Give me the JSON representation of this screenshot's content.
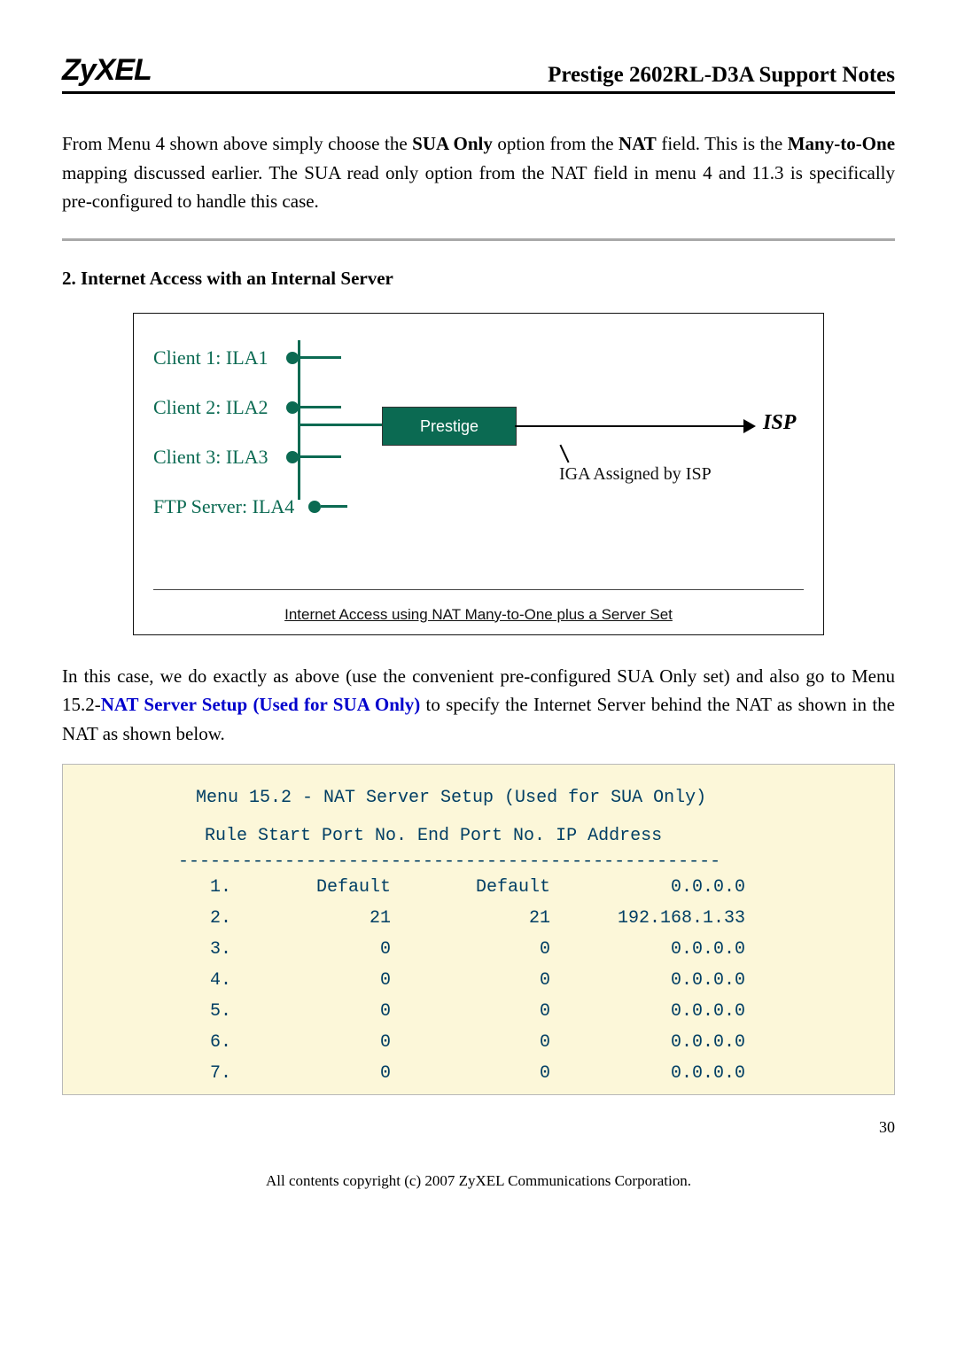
{
  "header": {
    "logo": "ZyXEL",
    "title": "Prestige 2602RL-D3A Support Notes"
  },
  "para1_pre": "From Menu 4 shown above simply choose the ",
  "para1_b1": "SUA Only",
  "para1_mid1": " option from the ",
  "para1_b2": "NAT",
  "para1_mid2": " field. This is the ",
  "para1_b3": "Many-to-One",
  "para1_post": " mapping discussed earlier. The SUA read only option from the NAT field in menu 4 and 11.3 is specifically pre-configured to handle this case.",
  "subhead": "2. Internet Access with an Internal Server",
  "diagram": {
    "c1": "Client 1: ILA1",
    "c2": "Client 2: ILA2",
    "c3": "Client 3: ILA3",
    "c4": "FTP Server: ILA4",
    "box": "Prestige",
    "isp": "ISP",
    "assigned": "IGA Assigned by ISP",
    "caption": "Internet Access using NAT Many-to-One plus a Server Set"
  },
  "para2_pre": "In this case, we do exactly as above (use the convenient pre-configured SUA Only set) and also go to Menu 15.2-",
  "para2_link": "NAT Server Setup (Used for SUA Only)",
  "para2_post": " to specify the Internet Server behind the NAT as shown in the NAT as shown below.",
  "code": {
    "title": "Menu 15.2 - NAT Server Setup (Used for SUA Only)",
    "sub": "Rule Start Port No. End Port No. IP Address",
    "dashes": "---------------------------------------------------"
  },
  "chart_data": {
    "type": "table",
    "columns": [
      "Rule",
      "Start Port No.",
      "End Port No.",
      "IP Address"
    ],
    "rows": [
      {
        "idx": "1.",
        "p1": "Default",
        "p2": "Default",
        "ip": "0.0.0.0"
      },
      {
        "idx": "2.",
        "p1": "21",
        "p2": "21",
        "ip": "192.168.1.33"
      },
      {
        "idx": "3.",
        "p1": "0",
        "p2": "0",
        "ip": "0.0.0.0"
      },
      {
        "idx": "4.",
        "p1": "0",
        "p2": "0",
        "ip": "0.0.0.0"
      },
      {
        "idx": "5.",
        "p1": "0",
        "p2": "0",
        "ip": "0.0.0.0"
      },
      {
        "idx": "6.",
        "p1": "0",
        "p2": "0",
        "ip": "0.0.0.0"
      },
      {
        "idx": "7.",
        "p1": "0",
        "p2": "0",
        "ip": "0.0.0.0"
      }
    ]
  },
  "footer": "All contents copyright (c) 2007 ZyXEL Communications Corporation.",
  "page": "30"
}
